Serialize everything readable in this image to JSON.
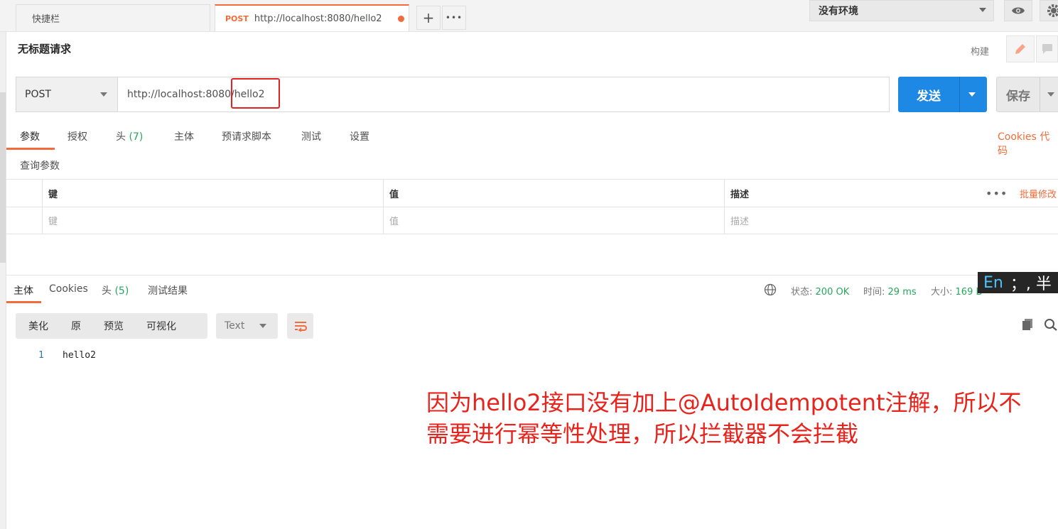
{
  "tabs": {
    "quick_label": "快捷栏",
    "active_method": "POST",
    "active_url": "http://localhost:8080/hello2",
    "new_tab_label": "+",
    "more_label": "•••"
  },
  "environment": {
    "selected": "没有环境"
  },
  "request": {
    "title": "无标题请求",
    "build_label": "构建",
    "method": "POST",
    "url": "http://localhost:8080/hello2",
    "send_label": "发送",
    "save_label": "保存"
  },
  "request_tabs": [
    {
      "label": "参数",
      "count": ""
    },
    {
      "label": "授权",
      "count": ""
    },
    {
      "label": "头",
      "count": "(7)"
    },
    {
      "label": "主体",
      "count": ""
    },
    {
      "label": "预请求脚本",
      "count": ""
    },
    {
      "label": "测试",
      "count": ""
    },
    {
      "label": "设置",
      "count": ""
    }
  ],
  "cookies_link": "Cookies  代码",
  "query_params": {
    "section_label": "查询参数",
    "headers": [
      "键",
      "值",
      "描述"
    ],
    "placeholders": [
      "键",
      "值",
      "描述"
    ],
    "more_label": "•••",
    "bulk_edit_label": "批量修改"
  },
  "response": {
    "tabs": [
      {
        "label": "主体",
        "count": ""
      },
      {
        "label": "Cookies",
        "count": ""
      },
      {
        "label": "头",
        "count": "(5)"
      },
      {
        "label": "测试结果",
        "count": ""
      }
    ],
    "status_label": "状态:",
    "status_value": "200 OK",
    "time_label": "时间:",
    "time_value": "29 ms",
    "size_label": "大小:",
    "size_value": "169 B",
    "view_modes": [
      "美化",
      "原",
      "预览",
      "可视化"
    ],
    "format": "Text",
    "body_lines": [
      {
        "num": "1",
        "text": "hello2"
      }
    ]
  },
  "ime": {
    "en": "En",
    "rest": "；, 半"
  },
  "annotation": {
    "line1": "因为hello2接口没有加上@AutoIdempotent注解，所以不",
    "line2": "需要进行幂等性处理，所以拦截器不会拦截"
  },
  "colors": {
    "accent": "#f26b3a",
    "send": "#1e88e5",
    "success": "#26a65b",
    "annotation": "#e8231c"
  }
}
